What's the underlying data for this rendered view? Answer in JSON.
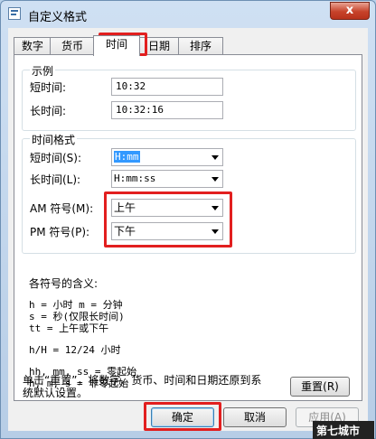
{
  "window": {
    "title": "自定义格式",
    "close_glyph": "x"
  },
  "tabs": [
    {
      "label": "数字"
    },
    {
      "label": "货币"
    },
    {
      "label": "时间"
    },
    {
      "label": "日期"
    },
    {
      "label": "排序"
    }
  ],
  "example": {
    "title": "示例",
    "short_label": "短时间:",
    "short_value": "10:32",
    "long_label": "长时间:",
    "long_value": "10:32:16"
  },
  "time_format": {
    "title": "时间格式",
    "short_label": "短时间(S):",
    "short_value": "H:mm",
    "long_label": "长时间(L):",
    "long_value": "H:mm:ss",
    "am_label": "AM 符号(M):",
    "am_value": "上午",
    "pm_label": "PM 符号(P):",
    "pm_value": "下午"
  },
  "legend": {
    "title": "各符号的含义:",
    "line1": "h = 小时   m = 分钟",
    "line2": "s = 秒(仅限长时间)",
    "line3": "tt = 上午或下午",
    "line4": "h/H = 12/24 小时",
    "line5": "hh, mm, ss = 零起始",
    "line6": "h, m, s = 非零起始"
  },
  "reset": {
    "text_line1": "单击“重置”，将数字、货币、时间和日期还原到系",
    "text_line2": "统默认设置。",
    "button": "重置(R)"
  },
  "buttons": {
    "ok": "确定",
    "cancel": "取消",
    "apply": "应用(A)"
  },
  "watermark": {
    "text": "第七城市"
  },
  "colors": {
    "highlight": "#e21f1f",
    "selection": "#3399ff"
  }
}
